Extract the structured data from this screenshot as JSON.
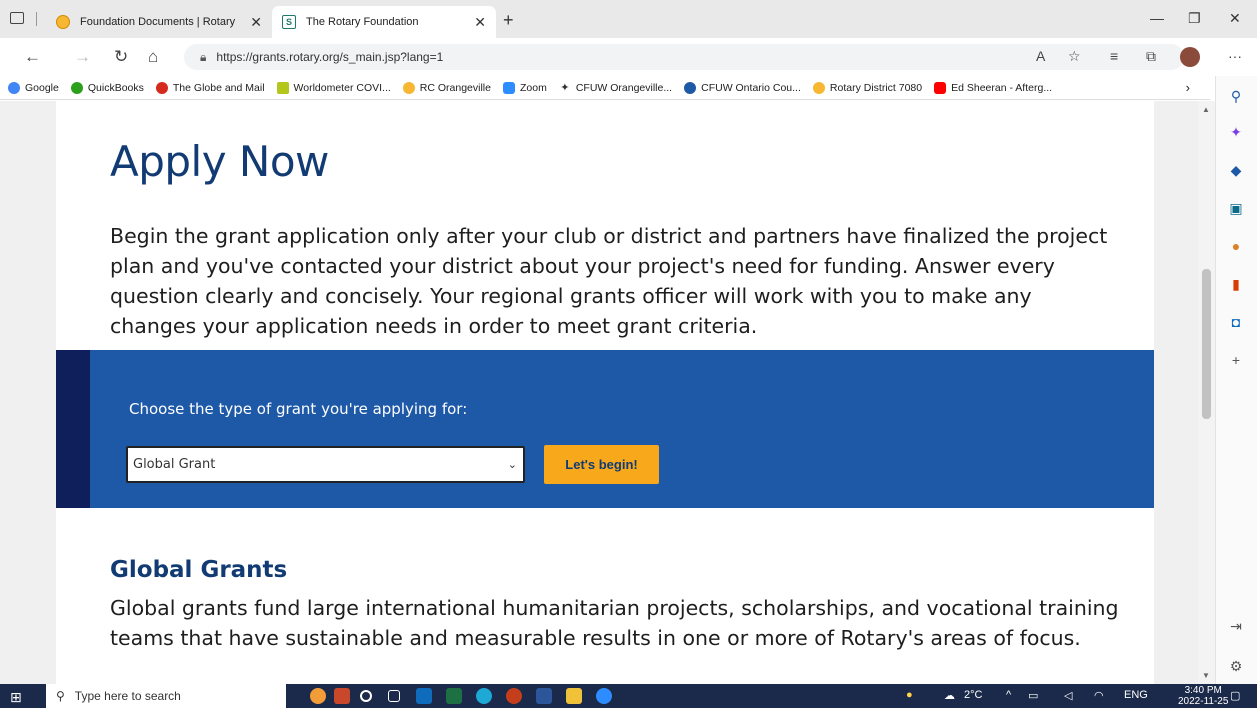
{
  "browser": {
    "tabs": [
      {
        "title": "Foundation Documents | Rotary",
        "active": false
      },
      {
        "title": "The Rotary Foundation",
        "active": true
      }
    ],
    "url": "https://grants.rotary.org/s_main.jsp?lang=1",
    "bookmarks": [
      {
        "label": "Google",
        "icon": "google-icon",
        "color": "#4285f4"
      },
      {
        "label": "QuickBooks",
        "icon": "quickbooks-icon",
        "color": "#2ca01c"
      },
      {
        "label": "The Globe and Mail",
        "icon": "maple-leaf-icon",
        "color": "#d52b1e"
      },
      {
        "label": "Worldometer COVI...",
        "icon": "worldometer-icon",
        "color": "#b5c61a"
      },
      {
        "label": "RC Orangeville",
        "icon": "rotary-icon",
        "color": "#f7b733"
      },
      {
        "label": "Zoom",
        "icon": "zoom-icon",
        "color": "#2d8cff"
      },
      {
        "label": "CFUW Orangeville...",
        "icon": "cfuw-icon",
        "color": "#333333"
      },
      {
        "label": "CFUW Ontario Cou...",
        "icon": "cfuw-ontario-icon",
        "color": "#1e59a8"
      },
      {
        "label": "Rotary District 7080",
        "icon": "rotary-icon",
        "color": "#f7b733"
      },
      {
        "label": "Ed Sheeran - Afterg...",
        "icon": "youtube-icon",
        "color": "#ff0000"
      }
    ]
  },
  "page": {
    "title": "Apply Now",
    "intro": "Begin the grant application only after your club or district and partners have finalized the project plan and you've contacted your district about your project's need for funding. Answer every question clearly and concisely. Your regional grants officer will work with you to make any changes your application needs in order to meet grant criteria.",
    "grant_prompt": "Choose the type of grant you're applying for:",
    "grant_select_value": "Global Grant",
    "begin_label": "Let's begin!",
    "section_title": "Global Grants",
    "section_text": "Global grants fund large international humanitarian projects, scholarships, and vocational training teams that have sustainable and measurable results in one or more of Rotary's areas of focus."
  },
  "taskbar": {
    "search_placeholder": "Type here to search",
    "weather": "2°C",
    "language": "ENG",
    "time": "3:40 PM",
    "date": "2022-11-25"
  },
  "colors": {
    "heading": "#123b74",
    "band": "#1e59a8",
    "band_stripe": "#0f1f5c",
    "button": "#f7a81b"
  }
}
